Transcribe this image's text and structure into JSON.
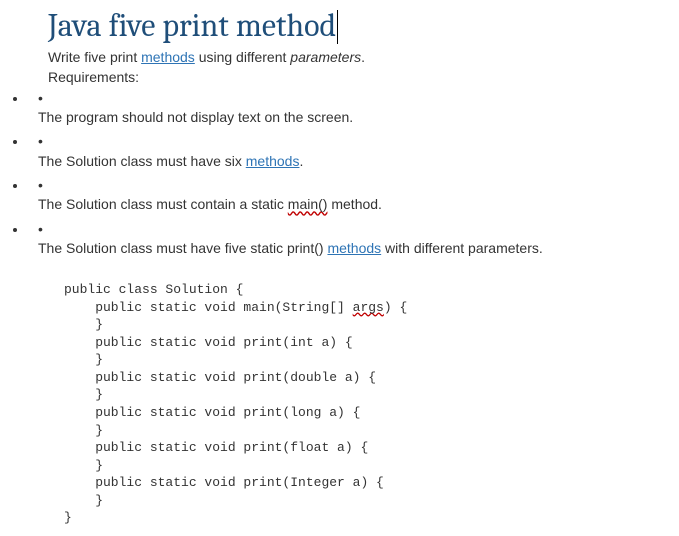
{
  "title": "Java five print method",
  "intro": {
    "pre": "Write five print ",
    "link": "methods",
    "mid": " using different ",
    "italic": "parameters",
    "post": "."
  },
  "requirements_label": "Requirements:",
  "bullets": [
    {
      "dot": "•",
      "parts": [
        {
          "t": "The program should not display text on the screen."
        }
      ]
    },
    {
      "dot": "•",
      "parts": [
        {
          "t": "The Solution class must have six "
        },
        {
          "t": "methods",
          "cls": "link-under"
        },
        {
          "t": "."
        }
      ]
    },
    {
      "dot": "•",
      "parts": [
        {
          "t": "The Solution class must contain a static "
        },
        {
          "t": "main()",
          "cls": "spell-under"
        },
        {
          "t": " method."
        }
      ]
    },
    {
      "dot": "•",
      "parts": [
        {
          "t": "The Solution class must have five static print() "
        },
        {
          "t": "methods",
          "cls": "link-under"
        },
        {
          "t": " with different parameters."
        }
      ]
    }
  ],
  "code": {
    "l1": "public class Solution {",
    "l2a": "    public static void main(String[] ",
    "l2b": "args",
    "l2c": ") {",
    "l3": "    }",
    "l4": "    public static void print(int a) {",
    "l5": "    }",
    "l6": "    public static void print(double a) {",
    "l7": "    }",
    "l8": "    public static void print(long a) {",
    "l9": "    }",
    "l10": "    public static void print(float a) {",
    "l11": "    }",
    "l12": "    public static void print(Integer a) {",
    "l13": "    }",
    "l14": "}"
  }
}
